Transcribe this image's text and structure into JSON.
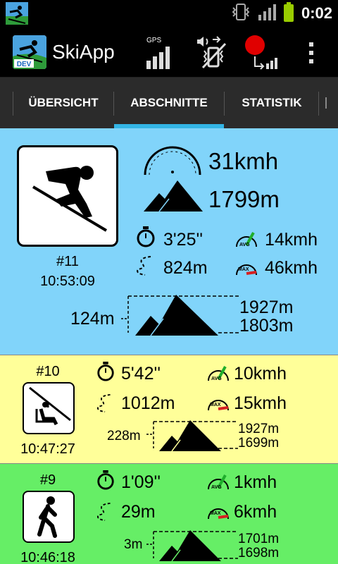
{
  "status_bar": {
    "time": "0:02"
  },
  "app_bar": {
    "title": "SkiApp",
    "logo_badge": "DEV",
    "gps_label": "GPS",
    "icons": [
      "gps-signal-icon",
      "vibrate-mute-icon",
      "record-icon",
      "overflow-menu-icon"
    ],
    "record_color": "#e00000"
  },
  "tabs": [
    {
      "label": "ÜBERSICHT"
    },
    {
      "label": "ABSCHNITTE"
    },
    {
      "label": "STATISTIK"
    }
  ],
  "sections": [
    {
      "type": "downhill",
      "icon": "skier-icon",
      "number": "#11",
      "time": "10:53:09",
      "speed": "31kmh",
      "altitude": "1799m",
      "duration": "3'25''",
      "distance": "824m",
      "avg_speed": "14kmh",
      "max_speed": "46kmh",
      "elevation_diff": "124m",
      "alt_max": "1927m",
      "alt_min": "1803m",
      "color": "#81d4fa"
    },
    {
      "type": "lift",
      "icon": "chairlift-icon",
      "number": "#10",
      "time": "10:47:27",
      "duration": "5'42''",
      "distance": "1012m",
      "avg_speed": "10kmh",
      "max_speed": "15kmh",
      "elevation_diff": "228m",
      "alt_max": "1927m",
      "alt_min": "1699m",
      "color": "#ffff99"
    },
    {
      "type": "walk",
      "icon": "walking-icon",
      "number": "#9",
      "time": "10:46:18",
      "duration": "1'09''",
      "distance": "29m",
      "avg_speed": "1kmh",
      "max_speed": "6kmh",
      "elevation_diff": "3m",
      "alt_max": "1701m",
      "alt_min": "1698m",
      "color": "#66ee66"
    }
  ],
  "badges": {
    "avg": "AVG",
    "max": "MAX"
  }
}
